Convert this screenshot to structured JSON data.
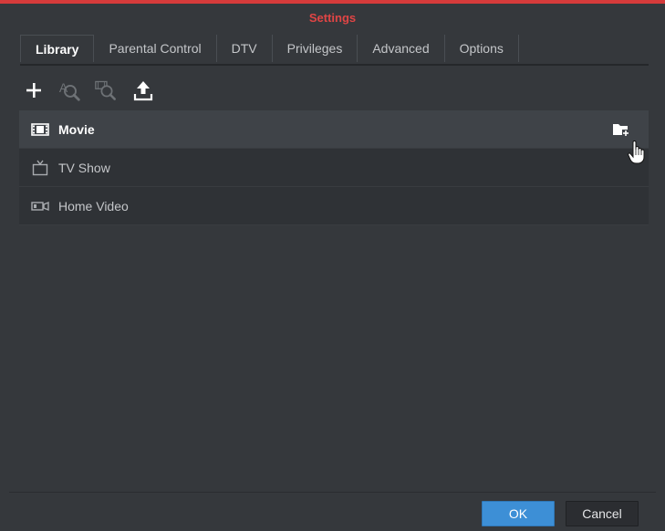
{
  "window": {
    "title": "Settings",
    "accent_color": "#d63b3b"
  },
  "tabs": [
    {
      "label": "Library",
      "active": true
    },
    {
      "label": "Parental Control",
      "active": false
    },
    {
      "label": "DTV",
      "active": false
    },
    {
      "label": "Privileges",
      "active": false
    },
    {
      "label": "Advanced",
      "active": false
    },
    {
      "label": "Options",
      "active": false
    }
  ],
  "toolbar": {
    "icons": [
      "add-icon",
      "search-text-icon",
      "search-image-icon",
      "upload-icon"
    ]
  },
  "library": {
    "items": [
      {
        "label": "Movie",
        "icon": "film-icon",
        "selected": true,
        "action_icon": "folder-add-icon"
      },
      {
        "label": "TV Show",
        "icon": "tv-icon",
        "selected": false
      },
      {
        "label": "Home Video",
        "icon": "video-camera-icon",
        "selected": false
      }
    ]
  },
  "footer": {
    "ok_label": "OK",
    "cancel_label": "Cancel",
    "ok_color": "#3d8fd6"
  }
}
